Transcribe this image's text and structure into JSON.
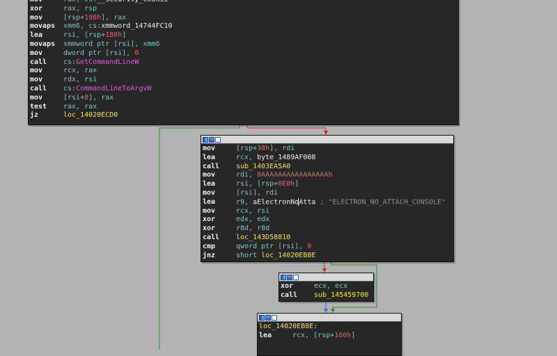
{
  "colors": {
    "background": "#b3b3b3",
    "node_bg": "#272727",
    "edge_green": "#2e8b2e",
    "edge_red": "#c62a2a",
    "edge_blue": "#3f6fd4"
  },
  "node1": {
    "lines": [
      {
        "m": "mov",
        "ops": [
          {
            "t": "reg",
            "v": "rax, cs:"
          },
          {
            "t": "sym",
            "v": "__security_cookie"
          }
        ]
      },
      {
        "m": "xor",
        "ops": [
          {
            "t": "reg",
            "v": "rax, rsp"
          }
        ]
      },
      {
        "m": "mov",
        "ops": [
          {
            "t": "reg",
            "v": "[rsp+"
          },
          {
            "t": "num",
            "v": "198h"
          },
          {
            "t": "reg",
            "v": "], rax"
          }
        ]
      },
      {
        "m": "movaps",
        "ops": [
          {
            "t": "reg",
            "v": "xmm6, cs:"
          },
          {
            "t": "sym",
            "v": "xmmword_14744FC10"
          }
        ]
      },
      {
        "m": "lea",
        "ops": [
          {
            "t": "reg",
            "v": "rsi, [rsp+"
          },
          {
            "t": "num",
            "v": "180h"
          },
          {
            "t": "reg",
            "v": "]"
          }
        ]
      },
      {
        "m": "movaps",
        "ops": [
          {
            "t": "reg",
            "v": "xmmword ptr [rsi], xmm6"
          }
        ]
      },
      {
        "m": "mov",
        "ops": [
          {
            "t": "reg",
            "v": "dword ptr [rsi], "
          },
          {
            "t": "num",
            "v": "0"
          }
        ]
      },
      {
        "m": "call",
        "ops": [
          {
            "t": "reg",
            "v": "cs:"
          },
          {
            "t": "fn",
            "v": "GetCommandLineW"
          }
        ]
      },
      {
        "m": "mov",
        "ops": [
          {
            "t": "reg",
            "v": "rcx, rax"
          }
        ]
      },
      {
        "m": "mov",
        "ops": [
          {
            "t": "reg",
            "v": "rdx, rsi"
          }
        ]
      },
      {
        "m": "call",
        "ops": [
          {
            "t": "reg",
            "v": "cs:"
          },
          {
            "t": "fn",
            "v": "CommandLineToArgvW"
          }
        ]
      },
      {
        "m": "mov",
        "ops": [
          {
            "t": "reg",
            "v": "[rsi+"
          },
          {
            "t": "num",
            "v": "8"
          },
          {
            "t": "reg",
            "v": "], rax"
          }
        ]
      },
      {
        "m": "test",
        "ops": [
          {
            "t": "reg",
            "v": "rax, rax"
          }
        ]
      },
      {
        "m": "jz",
        "ops": [
          {
            "t": "lbl",
            "v": "loc_14020ECD0"
          }
        ]
      }
    ]
  },
  "node2": {
    "lines": [
      {
        "m": "mov",
        "ops": [
          {
            "t": "reg",
            "v": "[rsp+"
          },
          {
            "t": "num",
            "v": "38h"
          },
          {
            "t": "reg",
            "v": "], rdi"
          }
        ]
      },
      {
        "m": "lea",
        "ops": [
          {
            "t": "reg",
            "v": "rcx, "
          },
          {
            "t": "sym",
            "v": "byte_1489AF008"
          }
        ]
      },
      {
        "m": "call",
        "ops": [
          {
            "t": "lbl",
            "v": "sub_1403EA5A0"
          }
        ]
      },
      {
        "m": "mov",
        "ops": [
          {
            "t": "reg",
            "v": "rdi, "
          },
          {
            "t": "num",
            "v": "0AAAAAAAAAAAAAAAAh"
          }
        ]
      },
      {
        "m": "lea",
        "ops": [
          {
            "t": "reg",
            "v": "rsi, [rsp+"
          },
          {
            "t": "num",
            "v": "0E0h"
          },
          {
            "t": "reg",
            "v": "]"
          }
        ]
      },
      {
        "m": "mov",
        "ops": [
          {
            "t": "reg",
            "v": "[rsi], rdi"
          }
        ]
      },
      {
        "m": "lea",
        "ops": [
          {
            "t": "reg",
            "v": "r9, "
          },
          {
            "t": "sym",
            "v": "aElectronNo"
          },
          {
            "t": "cursor",
            "v": ""
          },
          {
            "t": "sym",
            "v": "Atta"
          },
          {
            "t": "cmt",
            "v": " ; \"ELECTRON_NO_ATTACH_CONSOLE\""
          }
        ]
      },
      {
        "m": "mov",
        "ops": [
          {
            "t": "reg",
            "v": "rcx, rsi"
          }
        ]
      },
      {
        "m": "xor",
        "ops": [
          {
            "t": "reg",
            "v": "edx, edx"
          }
        ]
      },
      {
        "m": "xor",
        "ops": [
          {
            "t": "reg",
            "v": "r8d, r8d"
          }
        ]
      },
      {
        "m": "call",
        "ops": [
          {
            "t": "lbl",
            "v": "loc_143D58810"
          }
        ]
      },
      {
        "m": "cmp",
        "ops": [
          {
            "t": "reg",
            "v": "qword ptr [rsi], "
          },
          {
            "t": "num",
            "v": "0"
          }
        ]
      },
      {
        "m": "jnz",
        "ops": [
          {
            "t": "reg",
            "v": "short "
          },
          {
            "t": "lbl",
            "v": "loc_14020EB8E"
          }
        ]
      }
    ]
  },
  "node3": {
    "lines": [
      {
        "m": "xor",
        "ops": [
          {
            "t": "reg",
            "v": "ecx, ecx"
          }
        ]
      },
      {
        "m": "call",
        "ops": [
          {
            "t": "lbl",
            "v": "sub_145459700"
          }
        ]
      }
    ]
  },
  "node4": {
    "lines": [
      {
        "m": "",
        "ops": [
          {
            "t": "loc",
            "v": "loc_14020EB8E:"
          }
        ]
      },
      {
        "m": "lea",
        "ops": [
          {
            "t": "reg",
            "v": "rcx, [rsp+"
          },
          {
            "t": "num",
            "v": "160h"
          },
          {
            "t": "reg",
            "v": "]"
          }
        ]
      }
    ]
  }
}
